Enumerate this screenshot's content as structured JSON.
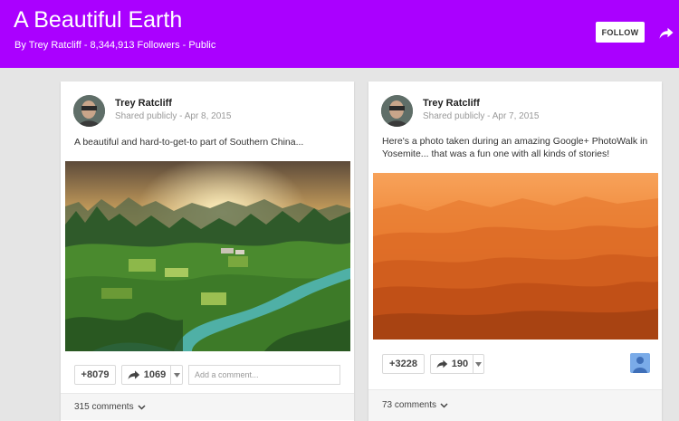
{
  "header": {
    "title": "A Beautiful Earth",
    "subtitle": "By Trey Ratcliff - 8,344,913 Followers - Public",
    "follow_label": "FOLLOW",
    "accent_color": "#aa00ff"
  },
  "posts": [
    {
      "author": "Trey Ratcliff",
      "visibility": "Shared publicly",
      "date": "Apr 8, 2015",
      "text": "A beautiful and hard-to-get-to part of Southern China...",
      "plus_count": "+8079",
      "share_count": "1069",
      "comment_placeholder": "Add a comment...",
      "comments_label": "315 comments"
    },
    {
      "author": "Trey Ratcliff",
      "visibility": "Shared publicly",
      "date": "Apr 7, 2015",
      "text": "Here's a photo taken during an amazing Google+ PhotoWalk in Yosemite... that was a fun one with all kinds of stories!",
      "plus_count": "+3228",
      "share_count": "190",
      "comments_label": "73 comments"
    }
  ],
  "icons": [
    "share-arrow-icon",
    "reshare-icon",
    "dropdown-arrow-icon",
    "chevron-down-icon",
    "user-avatar-icon"
  ]
}
